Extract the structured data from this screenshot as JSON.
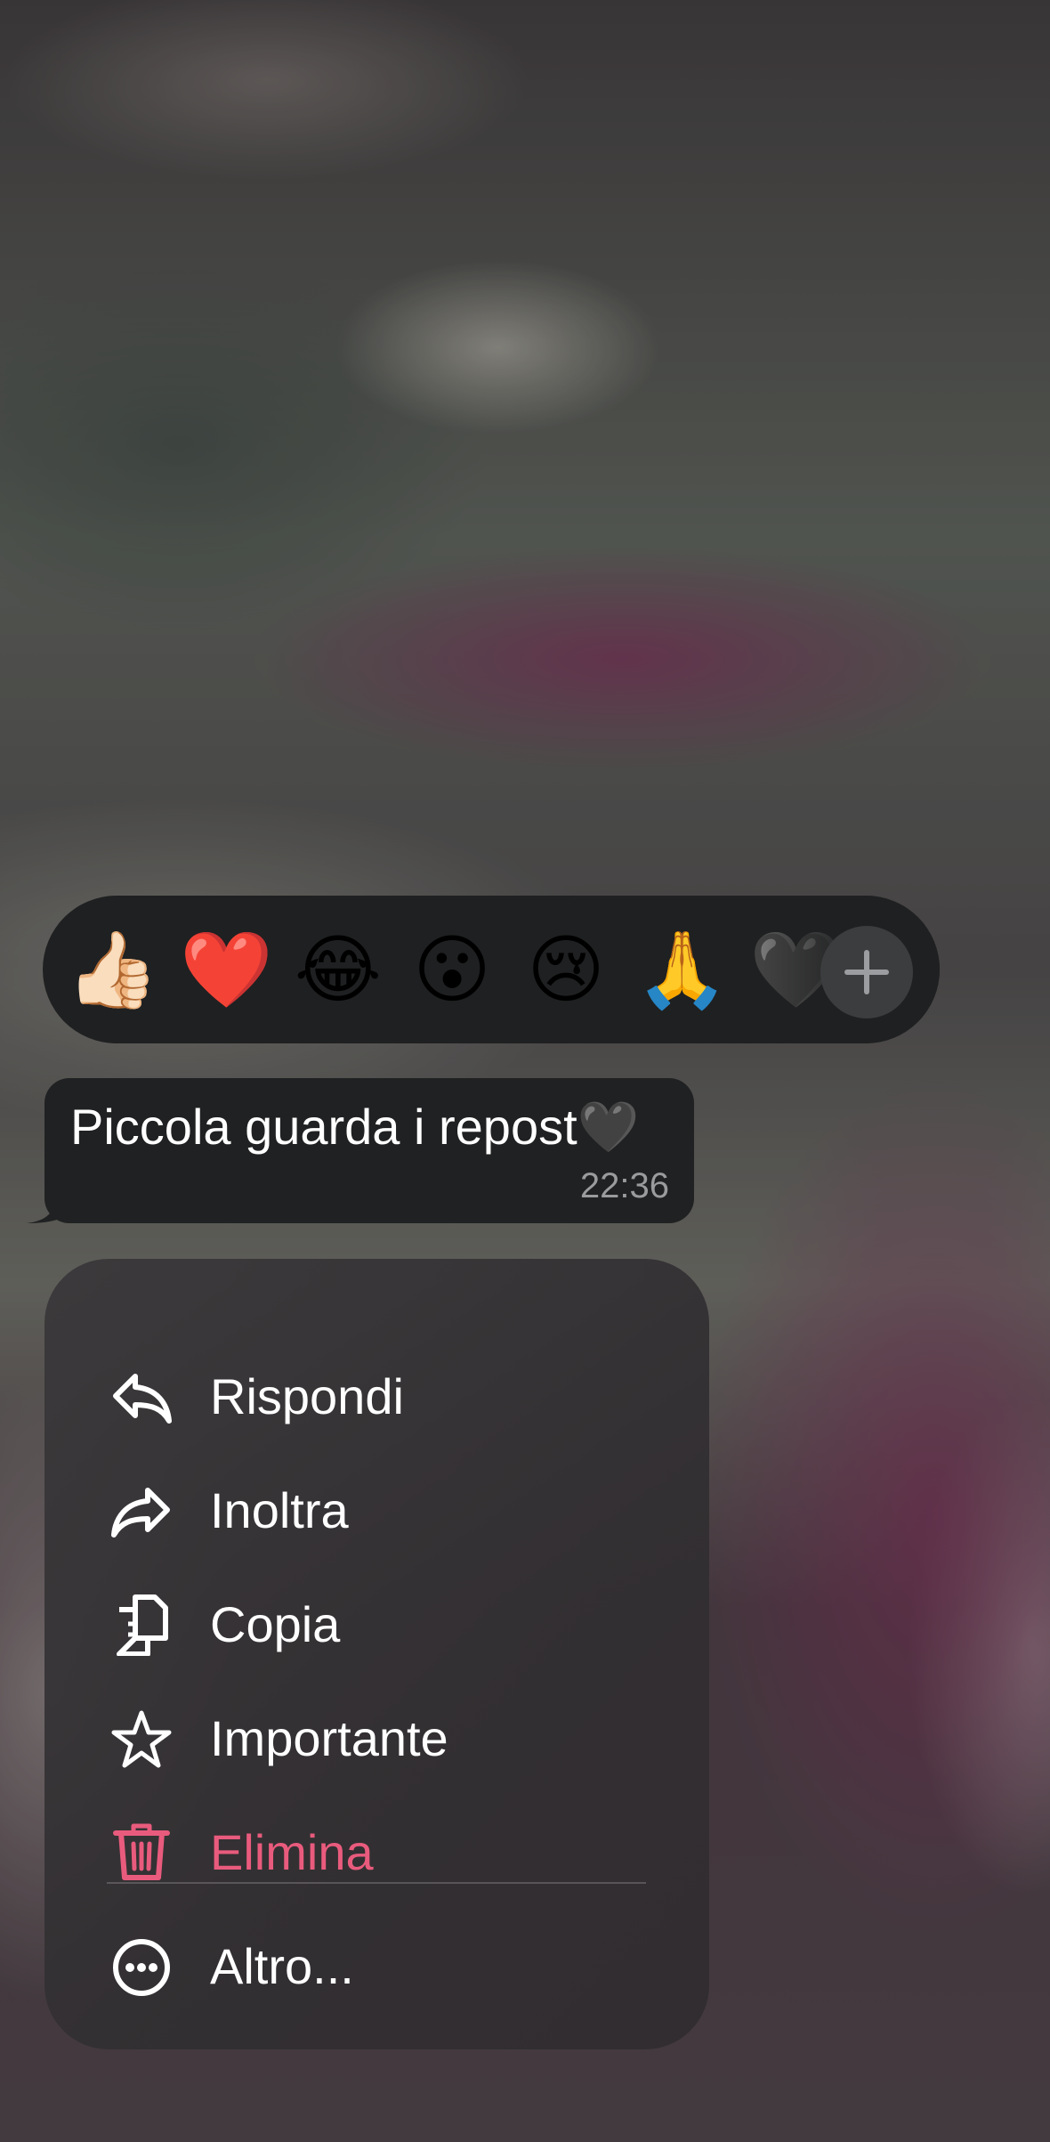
{
  "reactions": {
    "emojis": [
      "👍🏻",
      "❤️",
      "😂",
      "😮",
      "😢",
      "🙏",
      "🖤"
    ],
    "more_icon": "plus-icon"
  },
  "message": {
    "text": "Piccola guarda i repost🖤",
    "time": "22:36"
  },
  "menu": {
    "reply": {
      "label": "Rispondi",
      "icon": "reply-arrow-icon"
    },
    "forward": {
      "label": "Inoltra",
      "icon": "forward-arrow-icon"
    },
    "copy": {
      "label": "Copia",
      "icon": "copy-icon"
    },
    "star": {
      "label": "Importante",
      "icon": "star-icon"
    },
    "delete": {
      "label": "Elimina",
      "icon": "trash-icon"
    },
    "more": {
      "label": "Altro...",
      "icon": "more-dots-icon"
    }
  },
  "colors": {
    "danger": "#e95b7d",
    "bubble": "#202122",
    "menu": "#38353a"
  }
}
